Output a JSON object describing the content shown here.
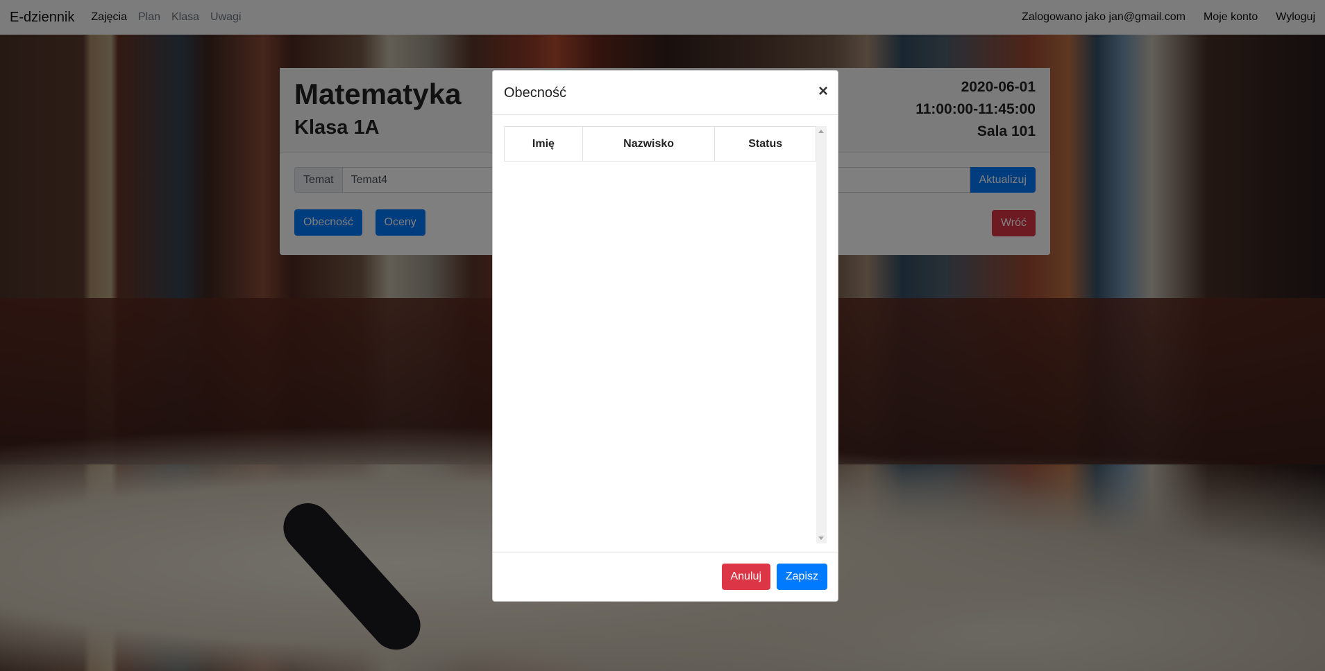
{
  "navbar": {
    "brand": "E-dziennik",
    "links": [
      "Zajęcia",
      "Plan",
      "Klasa",
      "Uwagi"
    ],
    "logged_in": "Zalogowano jako jan@gmail.com",
    "account": "Moje konto",
    "logout": "Wyloguj"
  },
  "lesson": {
    "subject": "Matematyka",
    "class": "Klasa 1A",
    "date": "2020-06-01",
    "time": "11:00:00-11:45:00",
    "room": "Sala 101",
    "topic_label": "Temat",
    "topic_value": "Temat4",
    "update_label": "Aktualizuj",
    "attendance_label": "Obecność",
    "grades_label": "Oceny",
    "back_label": "Wróć"
  },
  "modal": {
    "title": "Obecność",
    "close": "×",
    "columns": [
      "Imię",
      "Nazwisko",
      "Status"
    ],
    "rows": [],
    "cancel_label": "Anuluj",
    "save_label": "Zapisz"
  }
}
